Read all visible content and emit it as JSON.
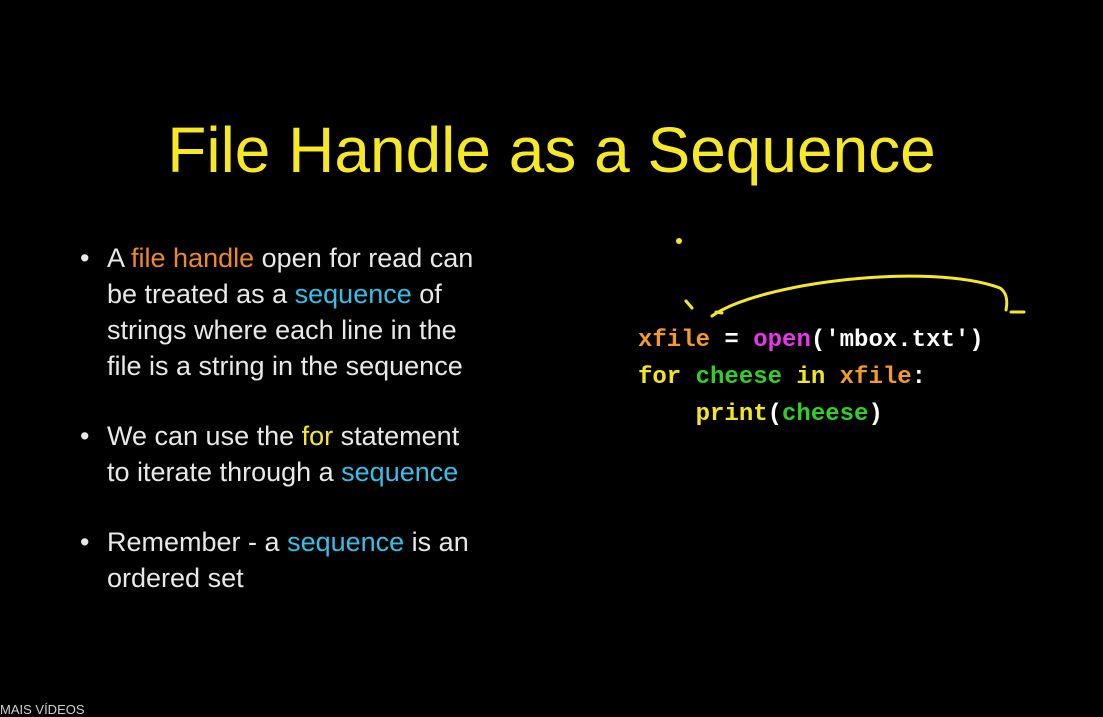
{
  "colors": {
    "title": "#f6e823",
    "text": "#e8e8e8",
    "orange": "#ef8a22",
    "cyan": "#35bfe8",
    "yellow": "#f6e823",
    "magenta": "#ea36ea",
    "green": "#30d02a",
    "white": "#ffffff",
    "code_orange": "#f39a2a",
    "code_yellow": "#f3e526",
    "footer": "#d0d0d0"
  },
  "slide": {
    "title": "File Handle as a Sequence",
    "bullet_marker": "•",
    "bullets": [
      {
        "lines": [
          [
            {
              "text": "A ",
              "color": "#e8e8e8"
            },
            {
              "text": "file handle",
              "color": "#ef8a22"
            },
            {
              "text": " open for read can",
              "color": "#e8e8e8"
            }
          ],
          [
            {
              "text": "be treated as a ",
              "color": "#e8e8e8"
            },
            {
              "text": "sequence",
              "color": "#35bfe8"
            },
            {
              "text": " of",
              "color": "#e8e8e8"
            }
          ],
          [
            {
              "text": "strings where each line in the",
              "color": "#e8e8e8"
            }
          ],
          [
            {
              "text": "file is a string in the sequence",
              "color": "#e8e8e8"
            }
          ]
        ]
      },
      {
        "lines": [
          [
            {
              "text": "We can use the ",
              "color": "#e8e8e8"
            },
            {
              "text": "for",
              "color": "#f6e823"
            },
            {
              "text": " statement",
              "color": "#e8e8e8"
            }
          ],
          [
            {
              "text": "to iterate through a ",
              "color": "#e8e8e8"
            },
            {
              "text": "sequence",
              "color": "#35bfe8"
            }
          ]
        ]
      },
      {
        "lines": [
          [
            {
              "text": "Remember - a ",
              "color": "#e8e8e8"
            },
            {
              "text": "sequence",
              "color": "#35bfe8"
            },
            {
              "text": " is an",
              "color": "#e8e8e8"
            }
          ],
          [
            {
              "text": "ordered set",
              "color": "#e8e8e8"
            }
          ]
        ]
      }
    ],
    "code": [
      [
        {
          "text": "xfile",
          "color": "#f39a2a"
        },
        {
          "text": " = ",
          "color": "#ffffff"
        },
        {
          "text": "open",
          "color": "#ea36ea"
        },
        {
          "text": "('mbox.txt')",
          "color": "#ffffff"
        }
      ],
      [
        {
          "text": "for ",
          "color": "#f3e526"
        },
        {
          "text": "cheese",
          "color": "#30d02a"
        },
        {
          "text": " in ",
          "color": "#f3e526"
        },
        {
          "text": "xfile",
          "color": "#f39a2a"
        },
        {
          "text": ":",
          "color": "#ffffff"
        }
      ],
      [
        {
          "text": "    ",
          "color": "#ffffff"
        },
        {
          "text": "print",
          "color": "#f3e526"
        },
        {
          "text": "(",
          "color": "#ffffff"
        },
        {
          "text": "cheese",
          "color": "#30d02a"
        },
        {
          "text": ")",
          "color": "#ffffff"
        }
      ]
    ]
  },
  "footer": {
    "label": "MAIS VÍDEOS"
  }
}
